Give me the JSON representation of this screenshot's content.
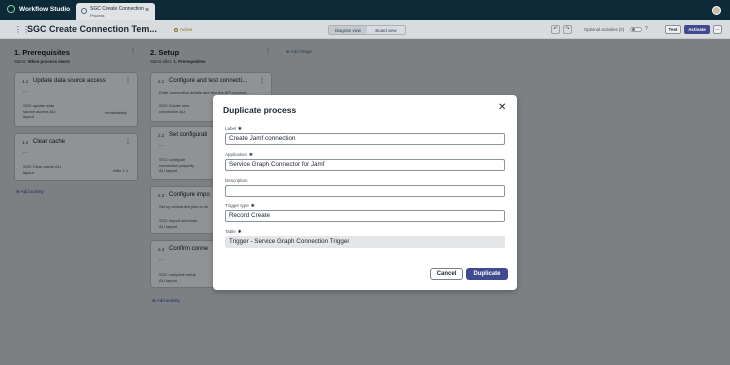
{
  "app": {
    "name": "Workflow Studio"
  },
  "tab": {
    "title": "SGC Create Connection",
    "subtitle": "Process",
    "close": "×"
  },
  "toolbar": {
    "title": "SGC Create Connection Tem...",
    "status": "Active",
    "diagram_view": "Diagram view",
    "board_view": "Board view",
    "optional_label": "Optional activities (0)",
    "help": "?",
    "test": "Test",
    "activate": "Activate",
    "more": "...",
    "undo": "↶",
    "redo": "↷"
  },
  "stages": [
    {
      "title": "1. Prerequisites",
      "starts_label": "Starts:",
      "starts_value": "When process starts",
      "activities": [
        {
          "num": "1.1",
          "title": "Update data source access",
          "dash": "- -",
          "detail": "SGC update data\nsource access ALI\nlayout",
          "timing": "Immediately"
        },
        {
          "num": "1.2",
          "title": "Clear cache",
          "dash": "- -",
          "detail": "SGC Clear cache ALI\nlayout",
          "timing": "After 1.1"
        }
      ],
      "add_activity": "Add activity"
    },
    {
      "title": "2. Setup",
      "starts_label": "Starts after:",
      "starts_value": "1. Prerequisites",
      "activities": [
        {
          "num": "2.1",
          "title": "Configure and test connecti...",
          "desc": "Enter connection details and test the API connect...",
          "detail": "SGC Create new\nconnection ALI"
        },
        {
          "num": "2.2",
          "title": "Set configurati",
          "dash": "- -",
          "detail": "SGC configure\nconnection property\nALI layout"
        },
        {
          "num": "2.3",
          "title": "Configure impo",
          "desc": "Set up scheduled jobs to im",
          "detail": "SGC Import schedule\nALI layout"
        },
        {
          "num": "2.4",
          "title": "Confirm conne",
          "dash": "- -",
          "detail": "SGC complete setup\nALI layout"
        }
      ],
      "add_activity": "Add activity"
    }
  ],
  "add_stage": "Add Stage",
  "modal": {
    "title": "Duplicate process",
    "close": "✕",
    "fields": [
      {
        "label": "Label",
        "value": "Create Jamf connection",
        "required": true
      },
      {
        "label": "Application",
        "value": "Service Graph Connector for Jamf",
        "required": true
      },
      {
        "label": "Description",
        "value": "",
        "required": false
      },
      {
        "label": "Trigger type",
        "value": "Record Create",
        "required": true
      },
      {
        "label": "Table",
        "value": "Trigger - Service Graph Connection Trigger",
        "required": true
      }
    ],
    "required_mark": "✱",
    "cancel": "Cancel",
    "duplicate": "Duplicate"
  }
}
